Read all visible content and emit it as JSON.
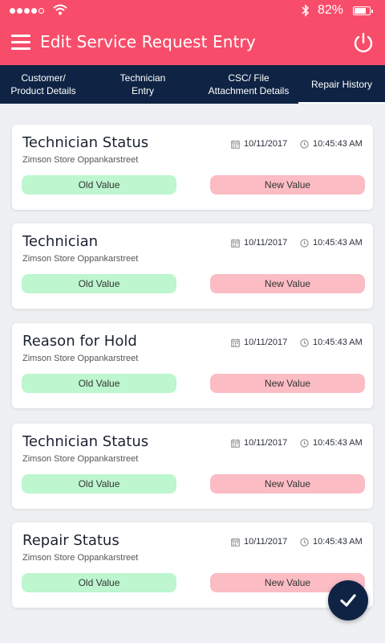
{
  "status_bar": {
    "battery_percent": "82%",
    "battery_level": 0.82,
    "signal_icon": "signal-dots-icon",
    "wifi_icon": "wifi-icon",
    "bluetooth_icon": "bluetooth-icon"
  },
  "app_bar": {
    "title": "Edit Service Request Entry",
    "menu_icon": "hamburger-menu-icon",
    "power_icon": "power-icon",
    "color": "#f84d6a"
  },
  "tabs": [
    {
      "label": "Customer/\nProduct Details",
      "active": false
    },
    {
      "label": "Technician\nEntry",
      "active": false
    },
    {
      "label": "CSC/ File\nAttachment Details",
      "active": false
    },
    {
      "label": "Repair History",
      "active": true
    }
  ],
  "history": [
    {
      "title": "Technician Status",
      "store": "Zimson Store Oppankarstreet",
      "date": "10/11/2017",
      "time": "10:45:43 AM",
      "old_label": "Old Value",
      "new_label": "New Value"
    },
    {
      "title": "Technician",
      "store": "Zimson Store Oppankarstreet",
      "date": "10/11/2017",
      "time": "10:45:43 AM",
      "old_label": "Old Value",
      "new_label": "New Value"
    },
    {
      "title": "Reason for Hold",
      "store": "Zimson Store Oppankarstreet",
      "date": "10/11/2017",
      "time": "10:45:43 AM",
      "old_label": "Old Value",
      "new_label": "New Value"
    },
    {
      "title": "Technician Status",
      "store": "Zimson Store Oppankarstreet",
      "date": "10/11/2017",
      "time": "10:45:43 AM",
      "old_label": "Old Value",
      "new_label": "New Value"
    },
    {
      "title": "Repair Status",
      "store": "Zimson Store Oppankarstreet",
      "date": "10/11/2017",
      "time": "10:45:43 AM",
      "old_label": "Old Value",
      "new_label": "New Value"
    }
  ],
  "fab": {
    "icon": "checkmark-icon",
    "color": "#0f2444"
  },
  "colors": {
    "old_value_bg": "#bdf6cf",
    "new_value_bg": "#fbbcc4",
    "tab_bar_bg": "#0f2444"
  }
}
